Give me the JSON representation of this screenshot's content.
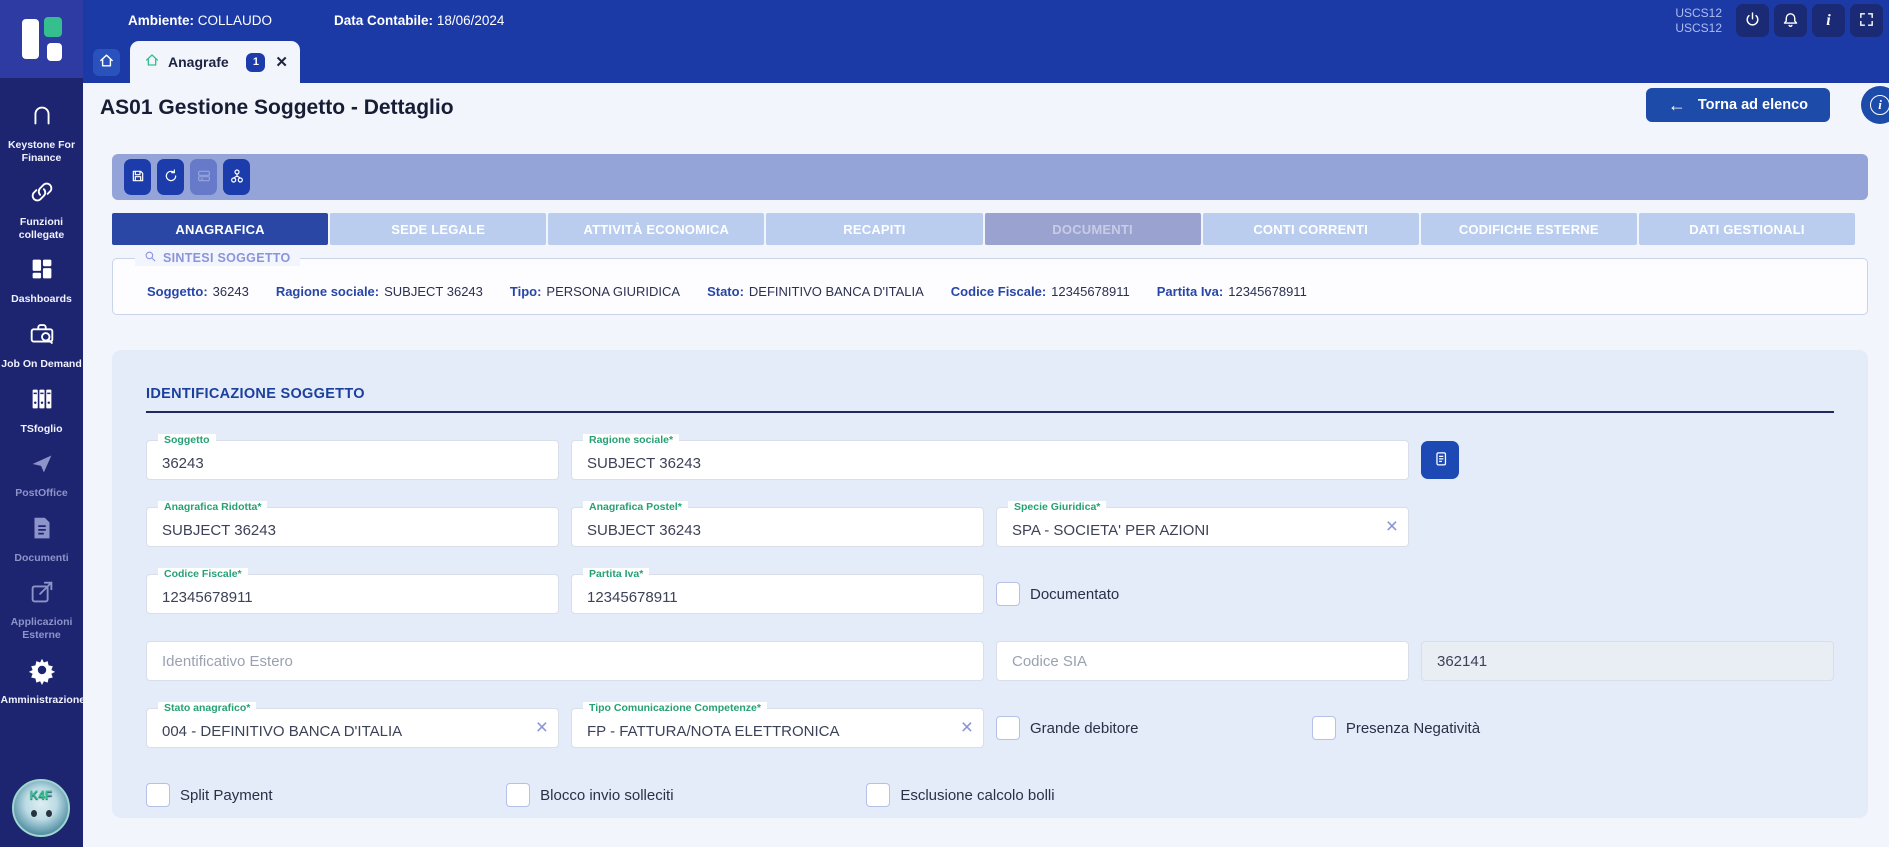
{
  "topbar": {
    "ambiente_label": "Ambiente:",
    "ambiente_value": " COLLAUDO",
    "data_contabile_label": "Data Contabile:",
    "data_contabile_value": " 18/06/2024",
    "user_line1": "USCS12",
    "user_line2": "USCS12",
    "icon_buttons": [
      "power-icon",
      "bell-icon",
      "info-icon",
      "fullscreen-icon"
    ]
  },
  "browser_tab": {
    "label": "Anagrafe",
    "badge": "1",
    "close": "✕"
  },
  "sidebar": {
    "items": [
      {
        "label": "Keystone For Finance",
        "icon": "keystone-arch-icon",
        "muted": false
      },
      {
        "label": "Funzioni collegate",
        "icon": "link-icon",
        "muted": false
      },
      {
        "label": "Dashboards",
        "icon": "grid-icon",
        "muted": false
      },
      {
        "label": "Job On Demand",
        "icon": "briefcase-search-icon",
        "muted": false
      },
      {
        "label": "TSfoglio",
        "icon": "binders-icon",
        "muted": false
      },
      {
        "label": "PostOffice",
        "icon": "send-icon",
        "muted": true
      },
      {
        "label": "Documenti",
        "icon": "document-icon",
        "muted": true
      },
      {
        "label": "Applicazioni Esterne",
        "icon": "external-link-icon",
        "muted": true
      },
      {
        "label": "Amministrazione",
        "icon": "gear-icon",
        "muted": false
      }
    ],
    "avatar_text": "K4F"
  },
  "page": {
    "title": "AS01 Gestione Soggetto - Dettaglio",
    "back_button": "Torna ad elenco",
    "back_arrow": "←"
  },
  "toolbar": {
    "buttons": [
      "save",
      "refresh",
      "list",
      "hierarchy"
    ]
  },
  "tabs": {
    "items": [
      {
        "label": "ANAGRAFICA",
        "state": "active"
      },
      {
        "label": "SEDE LEGALE",
        "state": "normal"
      },
      {
        "label": "ATTIVITÀ ECONOMICA",
        "state": "normal"
      },
      {
        "label": "RECAPITI",
        "state": "normal"
      },
      {
        "label": "DOCUMENTI",
        "state": "disabled"
      },
      {
        "label": "CONTI CORRENTI",
        "state": "normal"
      },
      {
        "label": "CODIFICHE ESTERNE",
        "state": "normal"
      },
      {
        "label": "DATI GESTIONALI",
        "state": "normal"
      }
    ]
  },
  "sintesi": {
    "title": "SINTESI SOGGETTO",
    "fields": [
      {
        "label": "Soggetto:",
        "value": "36243"
      },
      {
        "label": "Ragione sociale:",
        "value": "SUBJECT 36243"
      },
      {
        "label": "Tipo:",
        "value": "PERSONA GIURIDICA"
      },
      {
        "label": "Stato:",
        "value": "DEFINITIVO BANCA D'ITALIA"
      },
      {
        "label": "Codice Fiscale:",
        "value": "12345678911"
      },
      {
        "label": "Partita Iva:",
        "value": "12345678911"
      }
    ]
  },
  "form": {
    "section_title": "IDENTIFICAZIONE SOGGETTO",
    "soggetto": {
      "label": "Soggetto",
      "value": "36243"
    },
    "ragione_sociale": {
      "label": "Ragione sociale*",
      "value": "SUBJECT 36243"
    },
    "anagrafica_ridotta": {
      "label": "Anagrafica Ridotta*",
      "value": "SUBJECT 36243"
    },
    "anagrafica_postel": {
      "label": "Anagrafica Postel*",
      "value": "SUBJECT 36243"
    },
    "specie_giuridica": {
      "label": "Specie Giuridica*",
      "value": "SPA - SOCIETA' PER AZIONI"
    },
    "codice_fiscale": {
      "label": "Codice Fiscale*",
      "value": "12345678911"
    },
    "partita_iva": {
      "label": "Partita Iva*",
      "value": "12345678911"
    },
    "documentato": {
      "label": "Documentato",
      "checked": false
    },
    "identificativo_estero": {
      "placeholder": "Identificativo Estero",
      "value": ""
    },
    "codice_sia": {
      "placeholder": "Codice SIA",
      "value": ""
    },
    "codice_readonly": {
      "value": "362141"
    },
    "stato_anagrafico": {
      "label": "Stato anagrafico*",
      "value": "004 - DEFINITIVO BANCA D'ITALIA"
    },
    "tipo_comunicazione": {
      "label": "Tipo Comunicazione Competenze*",
      "value": "FP - FATTURA/NOTA ELETTRONICA"
    },
    "grande_debitore": {
      "label": "Grande debitore",
      "checked": false
    },
    "presenza_negativita": {
      "label": "Presenza Negatività",
      "checked": false
    },
    "split_payment": {
      "label": "Split Payment",
      "checked": false
    },
    "blocco_invio_solleciti": {
      "label": "Blocco invio solleciti",
      "checked": false
    },
    "esclusione_calcolo_bolli": {
      "label": "Esclusione calcolo bolli",
      "checked": false
    },
    "clear_x": "×"
  },
  "colors": {
    "topbar": "#1c3aa6",
    "sidebar": "#1e2570",
    "accent_green": "#35bf8e",
    "active_tab": "#2a47a6",
    "normal_tab": "#bacdee",
    "disabled_tab": "#9aa2cf",
    "toolbar_bar": "#95a4d8",
    "button_blue": "#1d3cab",
    "back_button": "#1d4ba9",
    "card_bg": "#e3ecf8",
    "field_label_green": "#27a173",
    "legend_purple": "#8a94dc"
  }
}
